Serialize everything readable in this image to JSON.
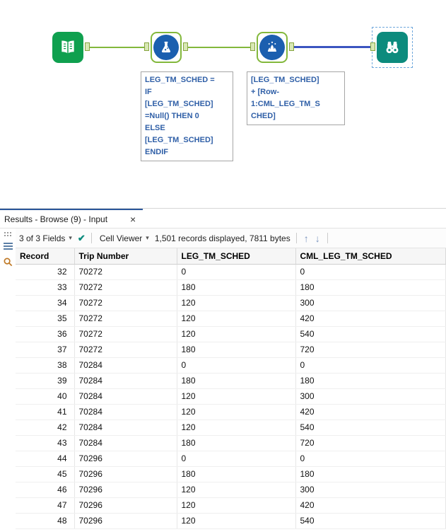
{
  "colors": {
    "tool_green": "#0FA04F",
    "tool_teal": "#0C8B7D",
    "tool_blue": "#1B5FAF",
    "connection_green": "#83B83C",
    "connection_blue": "#3B55C0",
    "annotation_text": "#2F5FA7"
  },
  "canvas": {
    "tools": [
      {
        "id": "input-data-tool",
        "icon": "book-icon"
      },
      {
        "id": "formula-tool",
        "icon": "flask-icon"
      },
      {
        "id": "multi-row-formula-tool",
        "icon": "splash-icon"
      },
      {
        "id": "browse-tool",
        "icon": "binoculars-icon"
      }
    ],
    "annotations": {
      "formula": "LEG_TM_SCHED =\nIF\n[LEG_TM_SCHED]\n=Null() THEN 0\nELSE\n[LEG_TM_SCHED]\nENDIF",
      "multi_row": "[LEG_TM_SCHED]\n+ [Row-\n1:CML_LEG_TM_S\nCHED]"
    }
  },
  "results": {
    "tab_label": "Results - Browse (9) - Input",
    "toolbar": {
      "fields_dropdown": "3 of 3 Fields",
      "cell_viewer_dropdown": "Cell Viewer",
      "records_summary": "1,501 records displayed, 7811 bytes"
    },
    "table": {
      "columns": [
        "Record",
        "Trip Number",
        "LEG_TM_SCHED",
        "CML_LEG_TM_SCHED"
      ],
      "rows": [
        [
          "32",
          "70272",
          "0",
          "0"
        ],
        [
          "33",
          "70272",
          "180",
          "180"
        ],
        [
          "34",
          "70272",
          "120",
          "300"
        ],
        [
          "35",
          "70272",
          "120",
          "420"
        ],
        [
          "36",
          "70272",
          "120",
          "540"
        ],
        [
          "37",
          "70272",
          "180",
          "720"
        ],
        [
          "38",
          "70284",
          "0",
          "0"
        ],
        [
          "39",
          "70284",
          "180",
          "180"
        ],
        [
          "40",
          "70284",
          "120",
          "300"
        ],
        [
          "41",
          "70284",
          "120",
          "420"
        ],
        [
          "42",
          "70284",
          "120",
          "540"
        ],
        [
          "43",
          "70284",
          "180",
          "720"
        ],
        [
          "44",
          "70296",
          "0",
          "0"
        ],
        [
          "45",
          "70296",
          "180",
          "180"
        ],
        [
          "46",
          "70296",
          "120",
          "300"
        ],
        [
          "47",
          "70296",
          "120",
          "420"
        ],
        [
          "48",
          "70296",
          "120",
          "540"
        ]
      ]
    }
  },
  "icons": {
    "close": "×",
    "dropdown": "▾",
    "check": "✔",
    "up": "↑",
    "down": "↓"
  }
}
